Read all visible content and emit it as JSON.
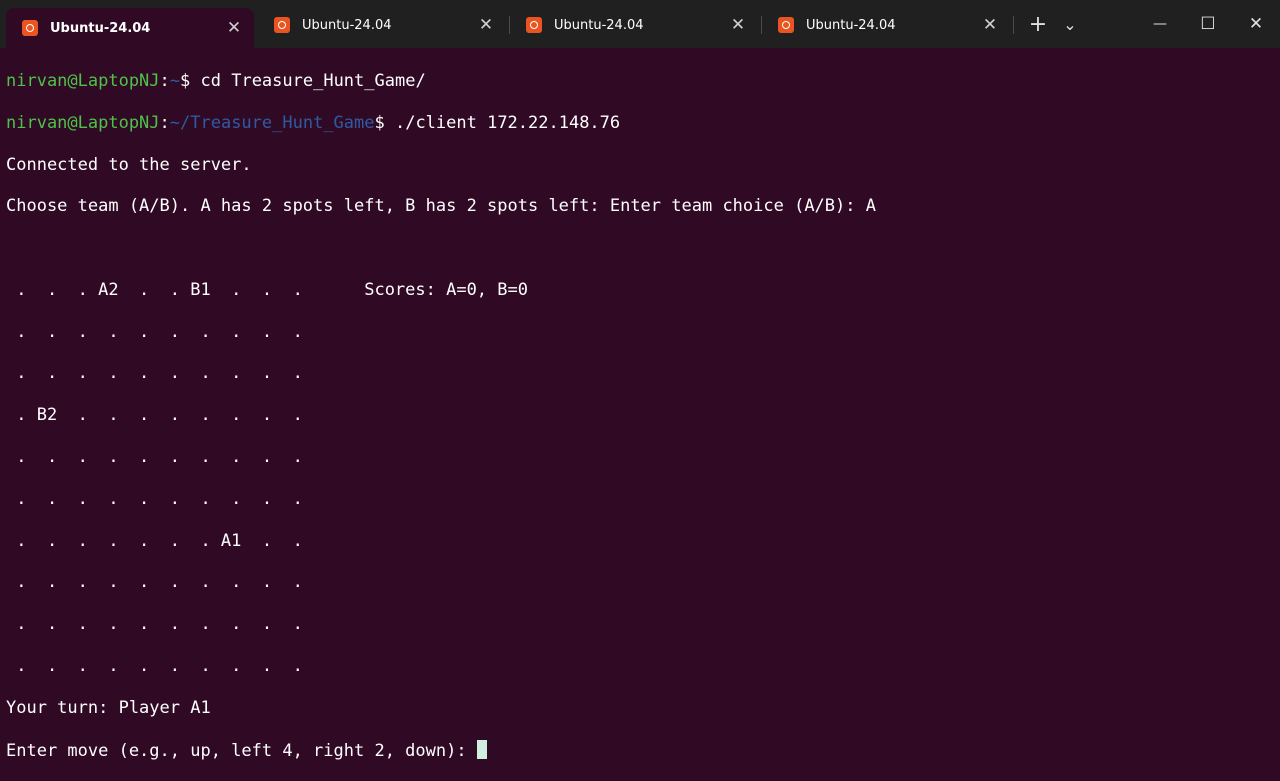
{
  "tabs": [
    {
      "label": "Ubuntu-24.04",
      "icon": "ubuntu-icon",
      "active": true
    },
    {
      "label": "Ubuntu-24.04",
      "icon": "ubuntu-icon",
      "active": false
    },
    {
      "label": "Ubuntu-24.04",
      "icon": "ubuntu-icon",
      "active": false
    },
    {
      "label": "Ubuntu-24.04",
      "icon": "ubuntu-icon",
      "active": false
    }
  ],
  "toolbar": {
    "new_tab": "+",
    "dropdown": "⌄",
    "minimize": "—",
    "maximize": "☐",
    "close": "✕"
  },
  "terminal": {
    "prompt1": {
      "user": "nirvan@LaptopNJ",
      "sep": ":",
      "path": "~",
      "sym": "$ ",
      "cmd": "cd Treasure_Hunt_Game/"
    },
    "prompt2": {
      "user": "nirvan@LaptopNJ",
      "sep": ":",
      "path": "~/Treasure_Hunt_Game",
      "sym": "$ ",
      "cmd": "./client 172.22.148.76"
    },
    "connected": "Connected to the server.",
    "choose": "Choose team (A/B). A has 2 spots left, B has 2 spots left: Enter team choice (A/B): A",
    "blank": "",
    "grid": [
      " .  .  . A2  .  . B1  .  .  .      Scores: A=0, B=0",
      " .  .  .  .  .  .  .  .  .  .",
      " .  .  .  .  .  .  .  .  .  .",
      " . B2  .  .  .  .  .  .  .  .",
      " .  .  .  .  .  .  .  .  .  .",
      " .  .  .  .  .  .  .  .  .  .",
      " .  .  .  .  .  .  . A1  .  .",
      " .  .  .  .  .  .  .  .  .  .",
      " .  .  .  .  .  .  .  .  .  .",
      " .  .  .  .  .  .  .  .  .  ."
    ],
    "turn": "Your turn: Player A1",
    "enter_move": "Enter move (e.g., up, left 4, right 2, down): "
  },
  "colors": {
    "background": "#300a24",
    "titlebar": "#202020",
    "user": "#4fc14a",
    "path": "#2f5aa3",
    "cursor": "#cfefe0"
  }
}
